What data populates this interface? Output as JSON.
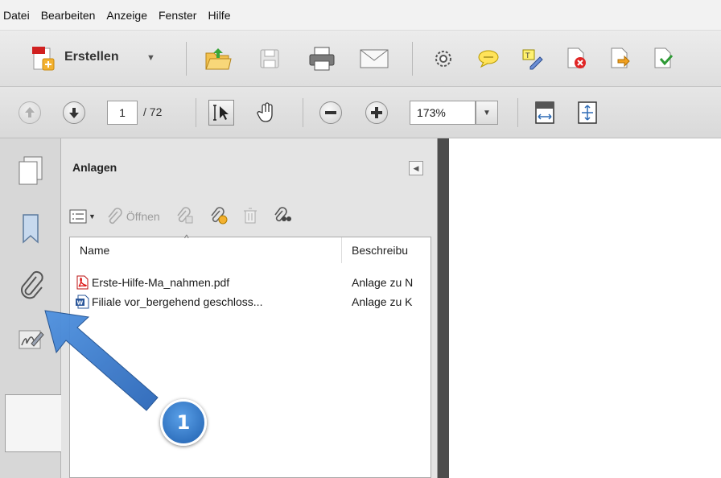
{
  "menu": {
    "items": [
      "Datei",
      "Bearbeiten",
      "Anzeige",
      "Fenster",
      "Hilfe"
    ]
  },
  "toolbar": {
    "create_label": "Erstellen",
    "icons": [
      "create-pdf-icon",
      "open-folder-icon",
      "save-icon",
      "print-icon",
      "email-icon",
      "settings-gear-icon",
      "comment-icon",
      "highlight-edit-icon",
      "reject-file-icon",
      "export-file-icon",
      "secure-file-icon"
    ]
  },
  "navigation": {
    "current_page": "1",
    "page_total": "/ 72",
    "zoom": "173%"
  },
  "panel": {
    "title": "Anlagen",
    "open_label": "Öffnen",
    "columns": {
      "name": "Name",
      "description": "Beschreibu"
    },
    "rows": [
      {
        "name": "Erste-Hilfe-Ma_nahmen.pdf",
        "description": "Anlage zu N",
        "type": "pdf"
      },
      {
        "name": "Filiale vor_bergehend geschloss...",
        "description": "Anlage zu K",
        "type": "word"
      }
    ]
  },
  "annotation": {
    "number": "1",
    "color": "#3a7fd0"
  }
}
